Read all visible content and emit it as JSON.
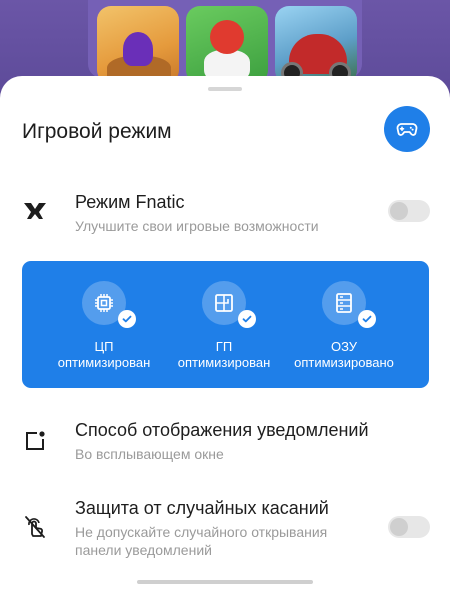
{
  "sheet": {
    "title": "Игровой режим",
    "game_button_icon": "gamepad-icon"
  },
  "fnatic": {
    "icon": "fnatic-logo-icon",
    "title": "Режим Fnatic",
    "subtitle": "Улучшите свои игровые возможности",
    "enabled": false
  },
  "optimization": {
    "background": "#1f7fe8",
    "items": [
      {
        "icon": "cpu-icon",
        "line1": "ЦП",
        "line2": "оптимизирован"
      },
      {
        "icon": "gpu-icon",
        "line1": "ГП",
        "line2": "оптимизирован"
      },
      {
        "icon": "ram-icon",
        "line1": "ОЗУ",
        "line2": "оптимизировано"
      }
    ]
  },
  "notifications": {
    "icon": "notification-style-icon",
    "title": "Способ отображения уведомлений",
    "subtitle": "Во всплывающем окне"
  },
  "touch_protection": {
    "icon": "touch-protection-icon",
    "title": "Защита от случайных касаний",
    "subtitle_line1": "Не допускайте случайного открывания",
    "subtitle_line2": "панели уведомлений",
    "enabled": false
  }
}
